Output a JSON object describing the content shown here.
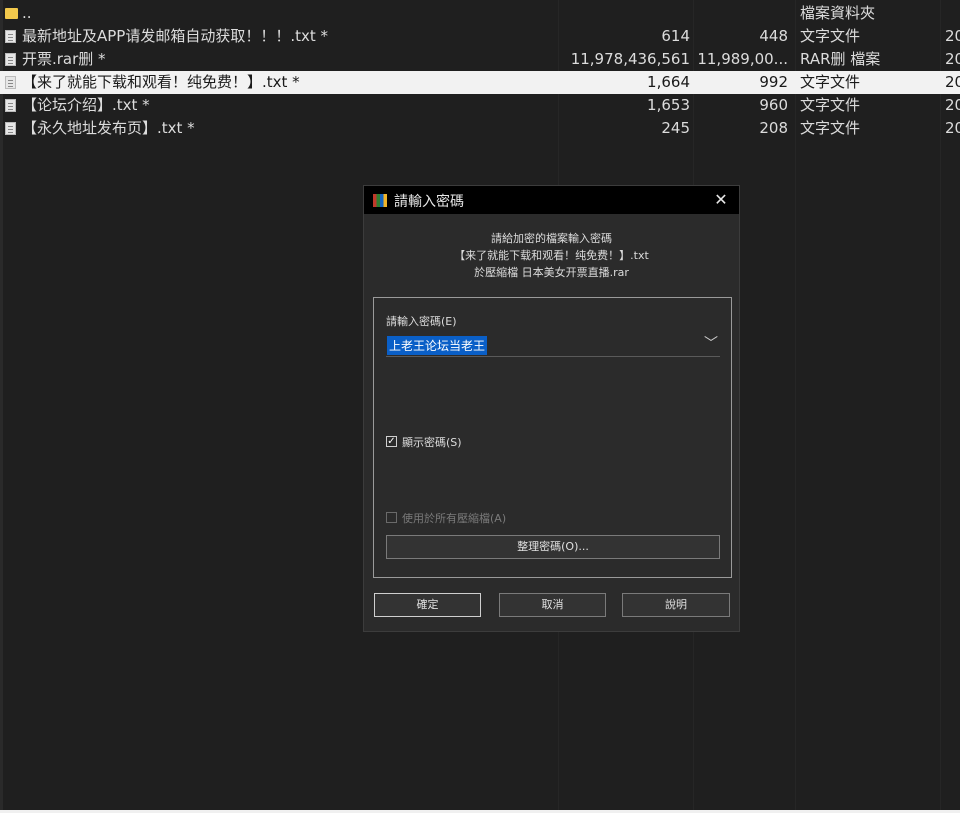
{
  "files": [
    {
      "icon": "folder",
      "name": "..",
      "size": "",
      "packed": "",
      "type": "檔案資料夾",
      "modified": ""
    },
    {
      "icon": "file",
      "name": "最新地址及APP请发邮箱自动获取！！！.txt *",
      "size": "614",
      "packed": "448",
      "type": "文字文件",
      "modified": "20"
    },
    {
      "icon": "file",
      "name": "开票.rar删 *",
      "size": "11,978,436,561",
      "packed": "11,989,00...",
      "type": "RAR删 檔案",
      "modified": "20"
    },
    {
      "icon": "file",
      "name": "【来了就能下载和观看！纯免费！】.txt *",
      "size": "1,664",
      "packed": "992",
      "type": "文字文件",
      "modified": "20",
      "selected": true
    },
    {
      "icon": "file",
      "name": "【论坛介绍】.txt *",
      "size": "1,653",
      "packed": "960",
      "type": "文字文件",
      "modified": "20"
    },
    {
      "icon": "file",
      "name": "【永久地址发布页】.txt *",
      "size": "245",
      "packed": "208",
      "type": "文字文件",
      "modified": "20"
    }
  ],
  "dialog": {
    "title": "請輸入密碼",
    "close": "✕",
    "info_line1": "請給加密的檔案輸入密碼",
    "info_line2": "【来了就能下载和观看！纯免费！】.txt",
    "info_line3": "於壓縮檔 日本美女开票直播.rar",
    "password_label": "請輸入密碼(E)",
    "password_value": "上老王论坛当老王",
    "dropdown_arrow": "﹀",
    "show_password_label": "顯示密碼(S)",
    "show_password_checked": true,
    "use_all_label": "使用於所有壓縮檔(A)",
    "use_all_checked": false,
    "manage_label": "整理密碼(O)...",
    "ok_label": "確定",
    "cancel_label": "取消",
    "help_label": "說明"
  }
}
